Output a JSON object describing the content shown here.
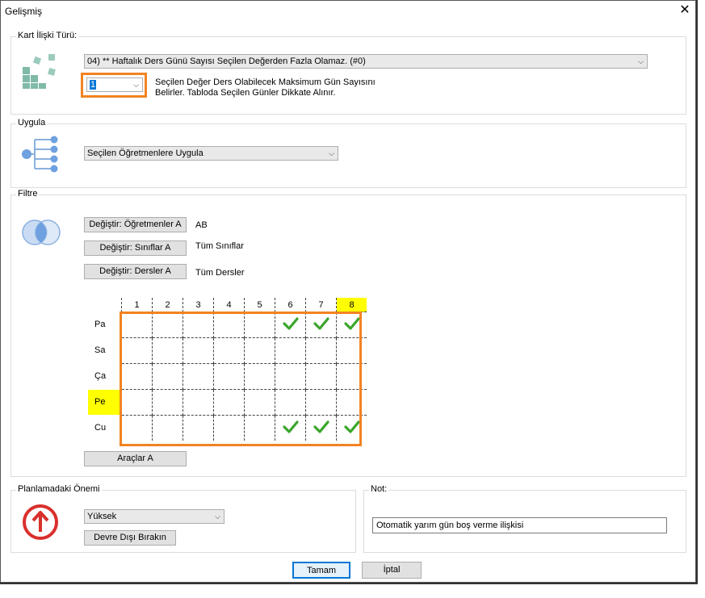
{
  "window": {
    "title": "Gelişmiş",
    "close_glyph": "✕"
  },
  "card_relation": {
    "group_label": "Kart İlişki Türü:",
    "type_value": "04) ** Haftalık Ders Günü Sayısı Seçilen Değerden Fazla Olamaz. (#0)",
    "count_value": "1",
    "description_line1": "Seçilen Değer Ders Olabilecek Maksimum Gün Sayısını",
    "description_line2": "Belirler. Tabloda Seçilen Günler Dikkate Alınır."
  },
  "apply": {
    "group_label": "Uygula",
    "target_value": "Seçilen Öğretmenlere Uygula"
  },
  "filter": {
    "group_label": "Filtre",
    "teachers_button": "Değiştir: Öğretmenler A",
    "teachers_value": "AB",
    "classes_button": "Değiştir: Sınıflar A",
    "classes_value": "Tüm Sınıflar",
    "lessons_button": "Değiştir: Dersler A",
    "lessons_value": "Tüm Dersler",
    "tools_button": "Araçlar A",
    "grid": {
      "columns": [
        "1",
        "2",
        "3",
        "4",
        "5",
        "6",
        "7",
        "8"
      ],
      "highlight_column": "8",
      "highlight_row": "Pe",
      "highlight_color": "#ffff00",
      "check_color": "#3aa52b",
      "rows": [
        {
          "label": "Pa",
          "checks": [
            false,
            false,
            false,
            false,
            false,
            true,
            true,
            true
          ]
        },
        {
          "label": "Sa",
          "checks": [
            false,
            false,
            false,
            false,
            false,
            false,
            false,
            false
          ]
        },
        {
          "label": "Ça",
          "checks": [
            false,
            false,
            false,
            false,
            false,
            false,
            false,
            false
          ]
        },
        {
          "label": "Pe",
          "checks": [
            false,
            false,
            false,
            false,
            false,
            false,
            false,
            false
          ]
        },
        {
          "label": "Cu",
          "checks": [
            false,
            false,
            false,
            false,
            false,
            true,
            true,
            true
          ]
        }
      ]
    }
  },
  "importance": {
    "group_label": "Planlamadaki Önemi",
    "level_value": "Yüksek",
    "disable_button": "Devre Dışı Bırakın"
  },
  "note": {
    "group_label": "Not:",
    "value": "Otomatik yarım gün boş verme ilişkisi"
  },
  "footer": {
    "ok_button": "Tamam",
    "cancel_button": "İptal"
  },
  "colors": {
    "accent_orange": "#f28322",
    "icon_teal": "#7fb9a7",
    "icon_blue": "#6fa0e0",
    "importance_red": "#d9302c"
  },
  "icons": {
    "card_relation": "blocks-icon",
    "apply": "tree-icon",
    "filter": "venn-icon",
    "importance": "arrow-up-circle-icon"
  }
}
